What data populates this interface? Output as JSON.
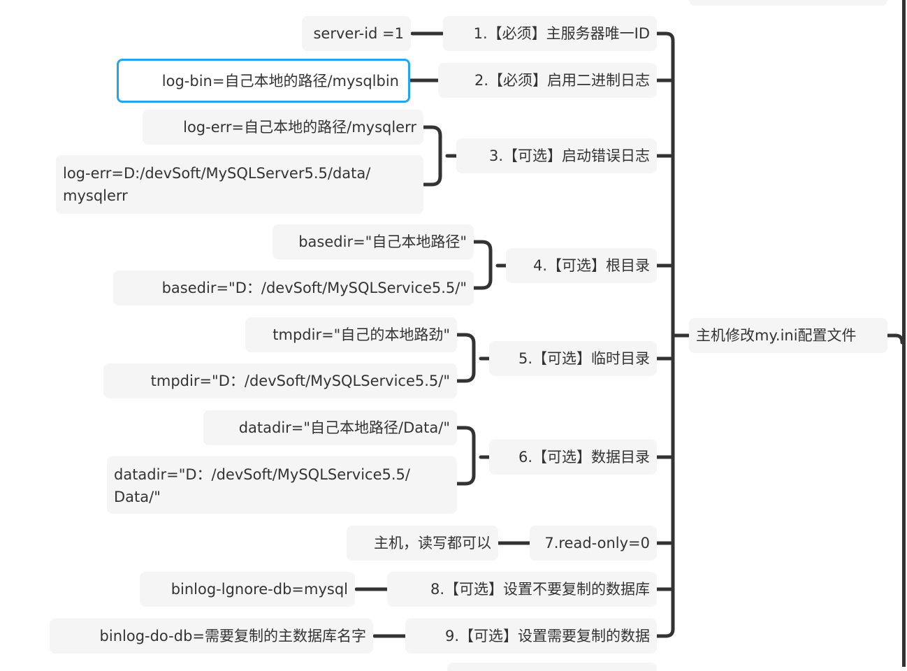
{
  "root": {
    "label": "主机修改my.ini配置文件"
  },
  "branches": [
    {
      "label": "1.【必须】主服务器唯一ID",
      "children": [
        "server-id =1"
      ]
    },
    {
      "label": "2.【必须】启用二进制日志",
      "children": [
        "log-bin=自己本地的路径/mysqlbin"
      ]
    },
    {
      "label": "3.【可选】启动错误日志",
      "children": [
        "log-err=自己本地的路径/mysqlerr",
        "log-err=D:/devSoft/MySQLServer5.5/data/mysqlerr"
      ]
    },
    {
      "label": "4.【可选】根目录",
      "children": [
        "basedir=\"自己本地路径\"",
        "basedir=\"D：/devSoft/MySQLService5.5/\""
      ]
    },
    {
      "label": "5.【可选】临时目录",
      "children": [
        "tmpdir=\"自己的本地路劲\"",
        "tmpdir=\"D：/devSoft/MySQLService5.5/\""
      ]
    },
    {
      "label": "6.【可选】数据目录",
      "children": [
        "datadir=\"自己本地路径/Data/\"",
        "datadir=\"D：/devSoft/MySQLService5.5/Data/\""
      ]
    },
    {
      "label": "7.read-only=0",
      "children": [
        "主机，读写都可以"
      ]
    },
    {
      "label": "8.【可选】设置不要复制的数据库",
      "children": [
        "binlog-lgnore-db=mysql"
      ]
    },
    {
      "label": "9.【可选】设置需要复制的数据",
      "children": [
        "binlog-do-db=需要复制的主数据库名字"
      ]
    }
  ],
  "multiline": {
    "err2_line1": "log-err=D:/devSoft/MySQLServer5.5/data/",
    "err2_line2": "mysqlerr",
    "data2_line1": "datadir=\"D：/devSoft/MySQLService5.5/",
    "data2_line2": "Data/\""
  },
  "colors": {
    "node_bg": "#f5f5f5",
    "line": "#333333",
    "selection": "#1ea7f0",
    "text": "#333333"
  }
}
